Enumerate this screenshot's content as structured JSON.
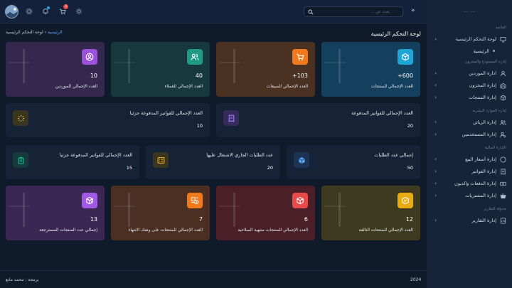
{
  "sidebar": {
    "brand": "— —",
    "menu_title": "القائمة",
    "items": [
      {
        "label": "لوحة التحكم الرئيسية",
        "icon": "monitor-icon",
        "chev": "‹"
      },
      {
        "label": "الرئيسية",
        "icon": "dot",
        "sub": true
      },
      {
        "section": "إدارة المستودع والمخزون"
      },
      {
        "label": "ادارة الموردين",
        "icon": "user-icon",
        "chev": "‹"
      },
      {
        "label": "إدارة المخزون",
        "icon": "warehouse-icon",
        "chev": "‹"
      },
      {
        "label": "إدارة المنتجات",
        "icon": "box-icon",
        "chev": "‹"
      },
      {
        "section": "إدارة الموارد البشرية"
      },
      {
        "label": "إدارة الزبائن",
        "icon": "users-icon",
        "chev": "‹"
      },
      {
        "label": "إدارة المستخدمين",
        "icon": "user-cog-icon",
        "chev": "‹"
      },
      {
        "section": "الإدارة المالية"
      },
      {
        "label": "إدارة أسعار البيع",
        "icon": "dollar-icon",
        "chev": "‹"
      },
      {
        "label": "إدارة الفواتير",
        "icon": "invoice-icon",
        "chev": "‹"
      },
      {
        "label": "إدارة الدفعات والديون",
        "icon": "cash-icon",
        "chev": "‹"
      },
      {
        "label": "إدارة المشتريات",
        "icon": "basket-icon",
        "chev": "‹"
      },
      {
        "section": "جدولة التقارير"
      },
      {
        "label": "إدارة التقارير",
        "icon": "report-icon",
        "chev": "‹"
      }
    ]
  },
  "topbar": {
    "search_placeholder": "بحث عن ...",
    "collapse_label": "»",
    "cart_badge": "3"
  },
  "page": {
    "title": "لوحة التحكم الرئيسية",
    "breadcrumb_home": "الرئيسية",
    "breadcrumb_sep": " ‹ ",
    "breadcrumb_current": "لوحة التحكم الرئيسية"
  },
  "row1": [
    {
      "value": "+600",
      "label": "العدد الإجمالي للمنتجات",
      "bg": "#14405e",
      "icon_bg": "#1ea5d6",
      "icon": "box-icon"
    },
    {
      "value": "+103",
      "label": "العدد الإجمالي للمبيعات",
      "bg": "#4a3121",
      "icon_bg": "#f07a1b",
      "icon": "cart-icon"
    },
    {
      "value": "40",
      "label": "العدد الإجمالي للعملاء",
      "bg": "#17383c",
      "icon_bg": "#1f9a85",
      "icon": "users-icon"
    },
    {
      "value": "10",
      "label": "العدد الإجمالي للموردين",
      "bg": "#35284e",
      "icon_bg": "#9b51d8",
      "icon": "user-circle-icon"
    }
  ],
  "row2": [
    {
      "value": "20",
      "label": "العدد الإجمالي للفواتير المدفوعة",
      "icon_bg": "#352a5c",
      "icon_color": "#a88bff",
      "icon": "invoice-icon"
    },
    {
      "value": "10",
      "label": "العدد الإجمالي للفواتير المدفوعة جزئيا",
      "icon_bg": "#3a3520",
      "icon_color": "#f5b82e",
      "icon": "loader-icon"
    }
  ],
  "row3": [
    {
      "value": "50",
      "label": "إجمالي عدد الطلبات",
      "icon_bg": "#1c3354",
      "icon_color": "#5aa7ff",
      "icon": "package-icon"
    },
    {
      "value": "20",
      "label": "عدد الطلبات الجاري الاشتغال عليها",
      "icon_bg": "#3a3520",
      "icon_color": "#f5b82e",
      "icon": "list-icon"
    },
    {
      "value": "15",
      "label": "العدد الإجمالي للفواتير المدفوعة جزئيا",
      "icon_bg": "#173a3c",
      "icon_color": "#25c3a5",
      "icon": "clipboard-icon"
    }
  ],
  "row4": [
    {
      "value": "12",
      "label": "العدد الإجمالي للمنتجات التالفة",
      "bg": "#3e3a1f",
      "icon_bg": "#e9ab12",
      "icon": "damaged-box-icon"
    },
    {
      "value": "6",
      "label": "العدد الإجمالي للمنتجات منتهية الصلاحية",
      "bg": "#4a1f28",
      "icon_bg": "#e84a4a",
      "icon": "expired-box-icon"
    },
    {
      "value": "7",
      "label": "العدد الإجمالي للمنتجات على وشك الانتهاء",
      "bg": "#4a2f22",
      "icon_bg": "#f07a1b",
      "icon": "timer-box-icon"
    },
    {
      "value": "13",
      "label": "إجمالي عدد المنتجات المسترجعة",
      "bg": "#3b2753",
      "icon_bg": "#a259e6",
      "icon": "return-box-icon"
    }
  ],
  "footer": {
    "year": "2024",
    "credit": "برمجة : محمد مانع"
  }
}
